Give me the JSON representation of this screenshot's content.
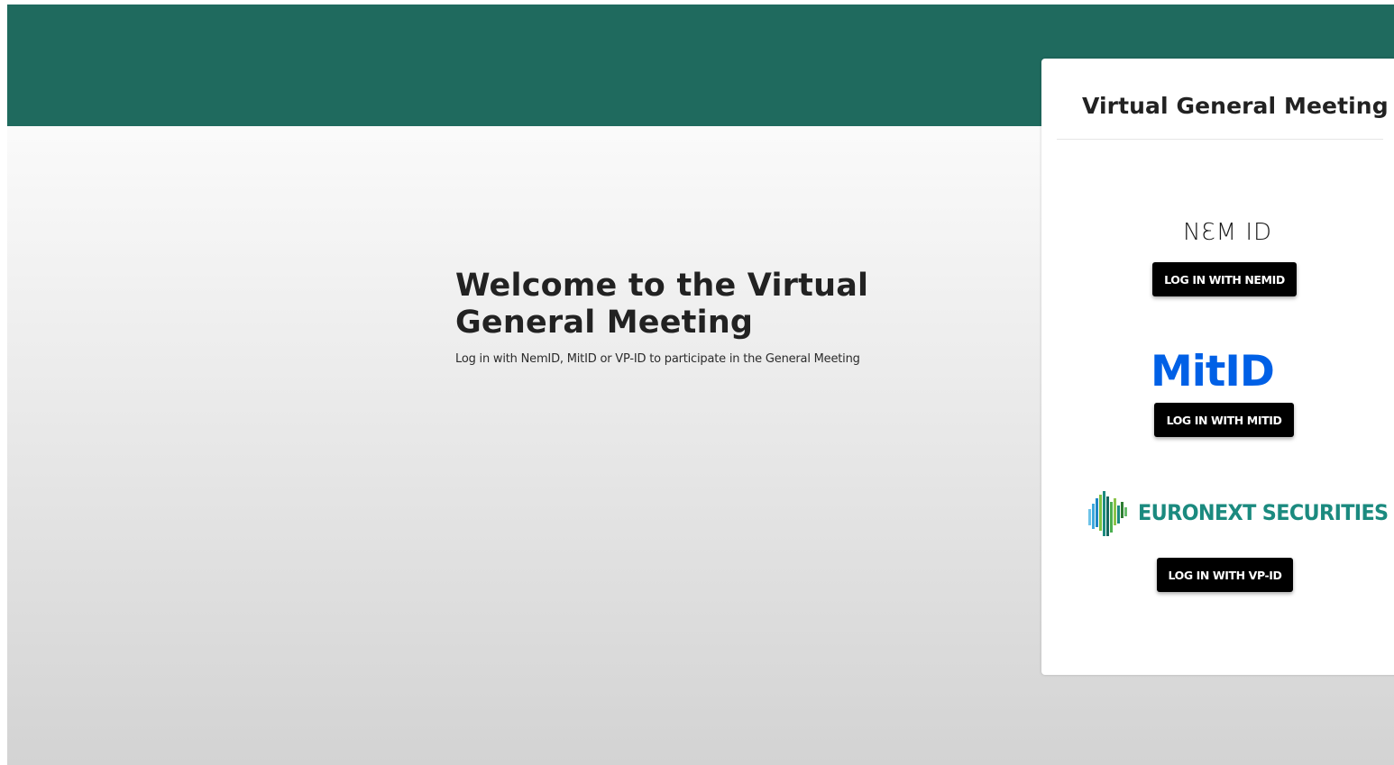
{
  "main": {
    "welcome_title_line1": "Welcome to the Virtual",
    "welcome_title_line2": "General Meeting",
    "welcome_subtitle": "Log in with NemID, MitID or VP-ID to participate in the General Meeting"
  },
  "login_card": {
    "title": "Virtual General Meeting",
    "nemid": {
      "logo_text": "NƐM ID",
      "button_label": "LOG IN WITH NEMID"
    },
    "mitid": {
      "logo_text": "MitID",
      "button_label": "LOG IN WITH MITID"
    },
    "vpid": {
      "logo_text": "EURONEXT SECURITIES",
      "button_label": "LOG IN WITH VP-ID"
    }
  },
  "colors": {
    "banner": "#1f6a5e",
    "button": "#000000",
    "mitid_blue": "#0060e6",
    "euronext_teal": "#1b8a7f"
  },
  "icons": [
    "nemid-logo",
    "mitid-logo",
    "euronext-logo-icon"
  ]
}
